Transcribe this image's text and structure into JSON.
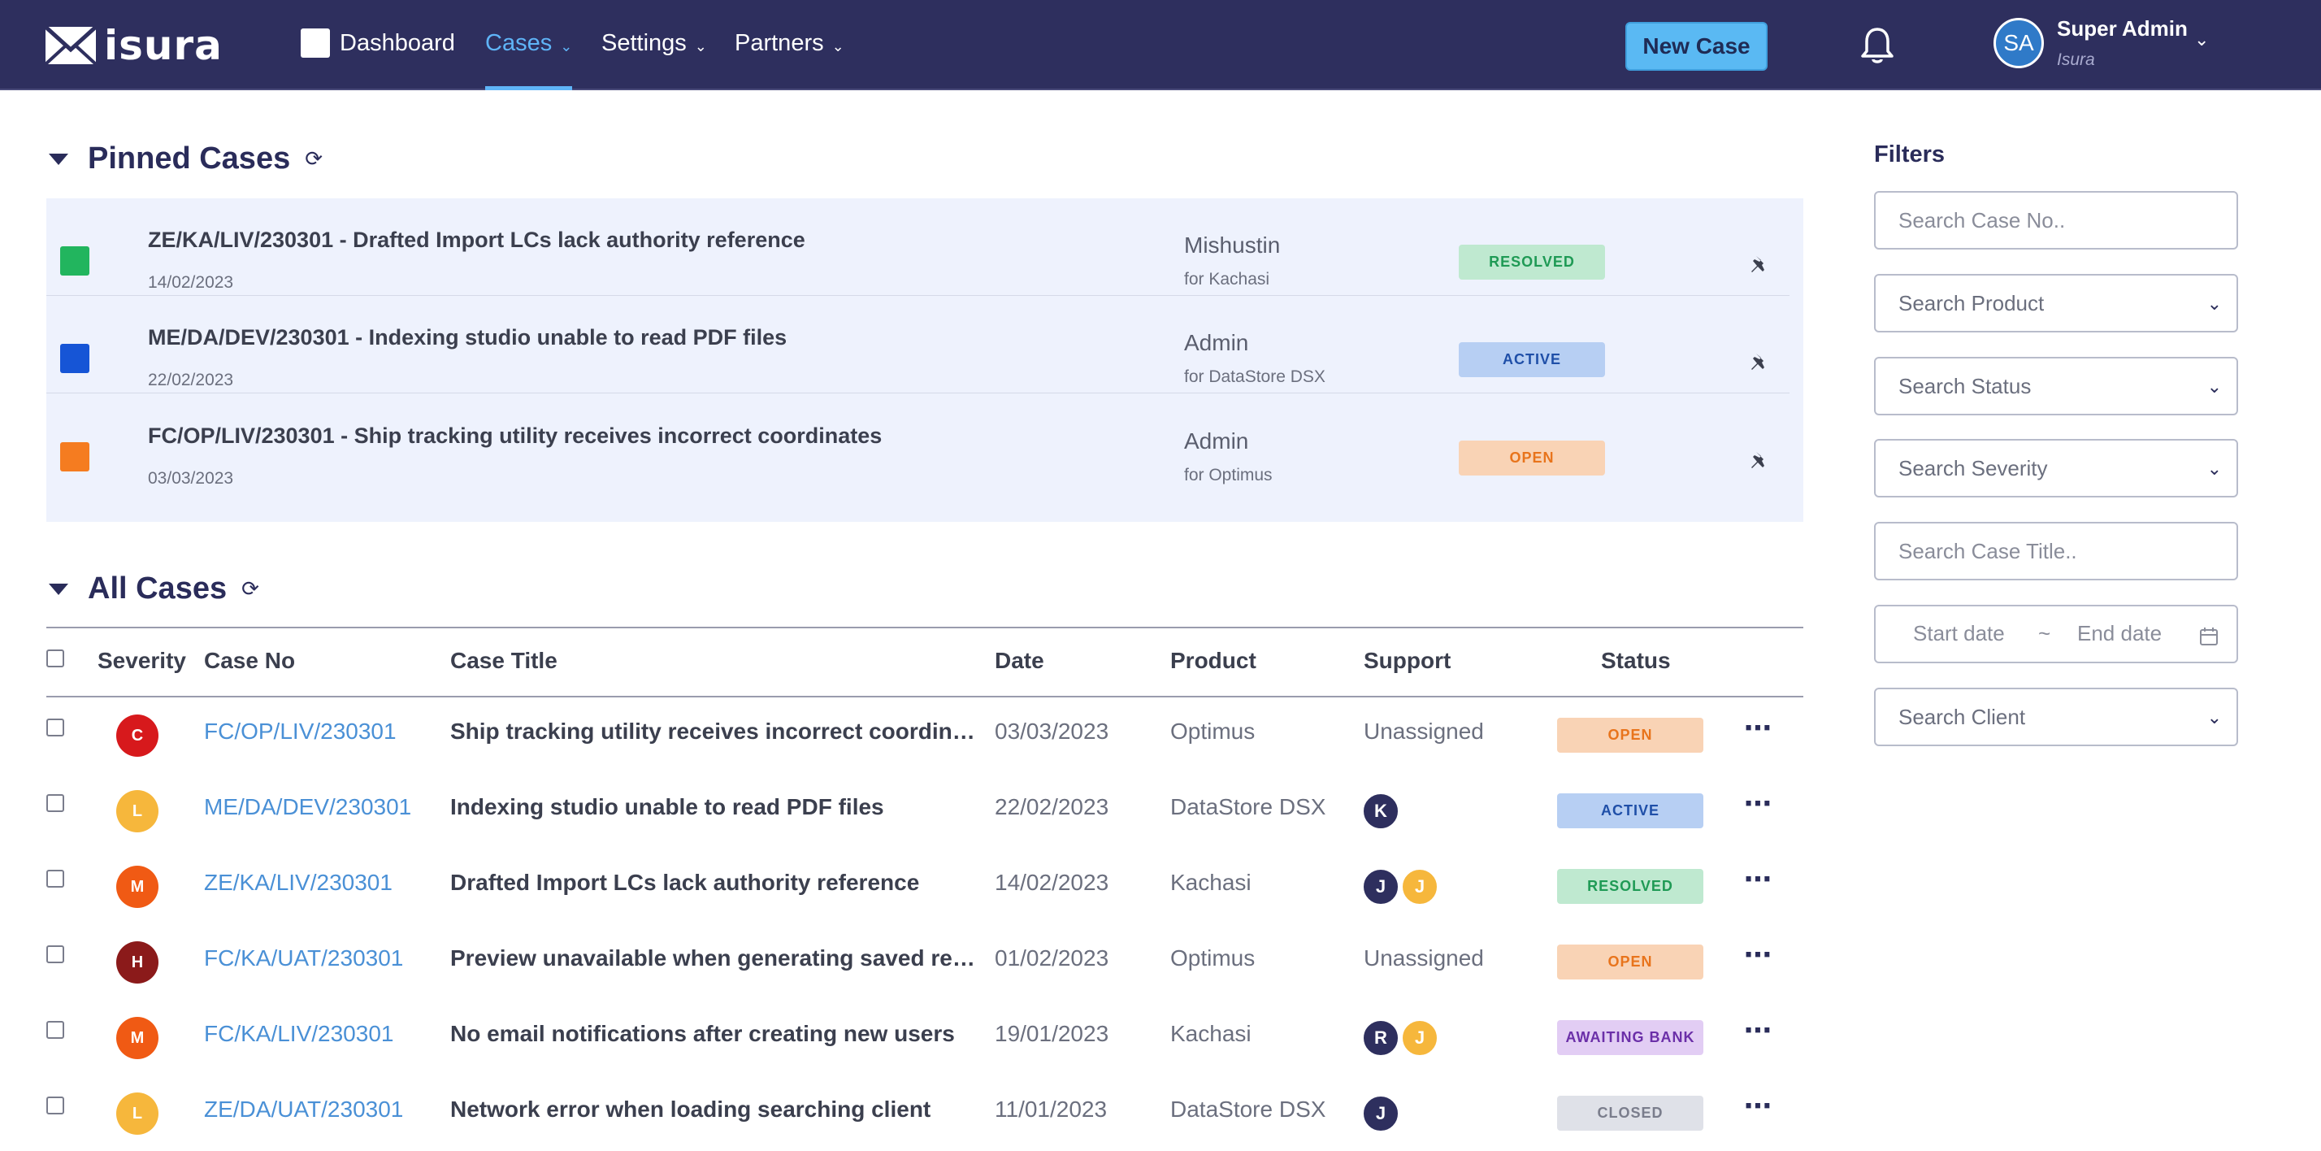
{
  "nav": {
    "brand": "isura",
    "items": [
      {
        "label": "Dashboard"
      },
      {
        "label": "Cases",
        "active": true
      },
      {
        "label": "Settings"
      },
      {
        "label": "Partners"
      }
    ],
    "new_case_label": "New Case",
    "user": {
      "initials": "SA",
      "name": "Super Admin",
      "org": "Isura"
    }
  },
  "pinned": {
    "title": "Pinned Cases",
    "rows": [
      {
        "title": "ZE/KA/LIV/230301 - Drafted Import LCs lack authority reference",
        "date": "14/02/2023",
        "who": "Mishustin",
        "for": "for Kachasi",
        "status": "RESOLVED",
        "square_color": "#22b55e"
      },
      {
        "title": "ME/DA/DEV/230301 - Indexing studio unable to read PDF files",
        "date": "22/02/2023",
        "who": "Admin",
        "for": "for DataStore DSX",
        "status": "ACTIVE",
        "square_color": "#1655d6"
      },
      {
        "title": "FC/OP/LIV/230301 - Ship tracking utility receives incorrect coordinates",
        "date": "03/03/2023",
        "who": "Admin",
        "for": "for Optimus",
        "status": "OPEN",
        "square_color": "#f57c20"
      }
    ]
  },
  "all_cases": {
    "title": "All Cases",
    "columns": {
      "severity": "Severity",
      "case_no": "Case No",
      "case_title": "Case Title",
      "date": "Date",
      "product": "Product",
      "support": "Support",
      "status": "Status"
    },
    "rows": [
      {
        "sev": "C",
        "sev_color": "#d7191c",
        "case_no": "FC/OP/LIV/230301",
        "title": "Ship tracking utility receives incorrect coordinates",
        "date": "03/03/2023",
        "product": "Optimus",
        "support_text": "Unassigned",
        "support": [],
        "status": "OPEN"
      },
      {
        "sev": "L",
        "sev_color": "#f6b73c",
        "case_no": "ME/DA/DEV/230301",
        "title": "Indexing studio unable to read PDF files",
        "date": "22/02/2023",
        "product": "DataStore DSX",
        "support_text": "",
        "support": [
          {
            "i": "K",
            "c": "#2e2f5e"
          }
        ],
        "status": "ACTIVE"
      },
      {
        "sev": "M",
        "sev_color": "#f05a14",
        "case_no": "ZE/KA/LIV/230301",
        "title": "Drafted Import LCs lack authority reference",
        "date": "14/02/2023",
        "product": "Kachasi",
        "support_text": "",
        "support": [
          {
            "i": "J",
            "c": "#2e2f5e"
          },
          {
            "i": "J",
            "c": "#f6b73c"
          }
        ],
        "status": "RESOLVED"
      },
      {
        "sev": "H",
        "sev_color": "#8b1a1a",
        "case_no": "FC/KA/UAT/230301",
        "title": "Preview unavailable when generating saved rep…",
        "date": "01/02/2023",
        "product": "Optimus",
        "support_text": "Unassigned",
        "support": [],
        "status": "OPEN"
      },
      {
        "sev": "M",
        "sev_color": "#f05a14",
        "case_no": "FC/KA/LIV/230301",
        "title": "No email notifications after creating new users",
        "date": "19/01/2023",
        "product": "Kachasi",
        "support_text": "",
        "support": [
          {
            "i": "R",
            "c": "#2e2f5e"
          },
          {
            "i": "J",
            "c": "#f6b73c"
          }
        ],
        "status": "AWAITING BANK"
      },
      {
        "sev": "L",
        "sev_color": "#f6b73c",
        "case_no": "ZE/DA/UAT/230301",
        "title": "Network error when loading searching client",
        "date": "11/01/2023",
        "product": "DataStore DSX",
        "support_text": "",
        "support": [
          {
            "i": "J",
            "c": "#2e2f5e"
          }
        ],
        "status": "CLOSED"
      }
    ]
  },
  "status_styles": {
    "RESOLVED": {
      "bg": "#bfe9d0",
      "fg": "#1f9a55"
    },
    "ACTIVE": {
      "bg": "#b7cff3",
      "fg": "#1f4fa8"
    },
    "OPEN": {
      "bg": "#f9d3b5",
      "fg": "#e8741c"
    },
    "AWAITING BANK": {
      "bg": "#e2cdf4",
      "fg": "#6b2fa8"
    },
    "CLOSED": {
      "bg": "#dfe1e8",
      "fg": "#7a7d8c"
    }
  },
  "filters": {
    "title": "Filters",
    "case_no_placeholder": "Search Case No..",
    "product": "Search Product",
    "status": "Search Status",
    "severity": "Search Severity",
    "case_title_placeholder": "Search Case Title..",
    "start_date": "Start date",
    "date_sep": "~",
    "end_date": "End date",
    "client": "Search Client"
  }
}
